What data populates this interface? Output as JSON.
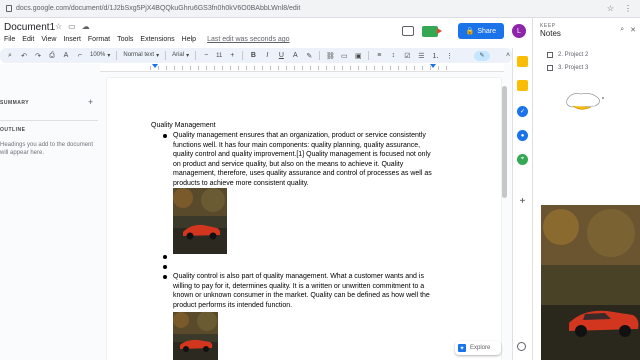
{
  "browser": {
    "url": "docs.google.com/document/d/1J2bSxg5PjX4BQQkuGhru6GS3fn0h0kV6O0BAbbLWnl8/edit"
  },
  "header": {
    "doc_title": "Document1",
    "menus": [
      "File",
      "Edit",
      "View",
      "Insert",
      "Format",
      "Tools",
      "Extensions",
      "Help"
    ],
    "last_edit": "Last edit was seconds ago",
    "share_label": "Share",
    "avatar_initial": "L"
  },
  "toolbar": {
    "zoom": "100%",
    "style": "Normal text",
    "font": "Arial",
    "font_size": "11",
    "minus": "−",
    "plus": "+",
    "bold": "B",
    "italic": "I",
    "underline": "U"
  },
  "outline": {
    "summary": "SUMMARY",
    "outline": "OUTLINE",
    "hint": "Headings you add to the document will appear here."
  },
  "document": {
    "heading": "Quality Management",
    "para1": "Quality management ensures that an organization, product or service consistently functions well. It has four main components: quality planning, quality assurance, quality control and quality improvement.[1] Quality management is focused not only on product and service quality, but also on the means to achieve it. Quality management, therefore, uses quality assurance and control of processes as well as products to achieve more consistent quality.",
    "para2": "Quality control is also part of quality management. What a customer wants and is willing to pay for it, determines quality. It is a written or unwritten commitment to a known or unknown consumer in the market. Quality can be defined as how well the product performs its intended function."
  },
  "explore": {
    "label": "Explore"
  },
  "keep": {
    "label": "KEEP",
    "title": "Notes",
    "items": [
      "2. Project 2",
      "3. Project 3"
    ]
  },
  "colors": {
    "accent": "#1a73e8",
    "avatar": "#8e24aa",
    "car": "#d3361f"
  }
}
